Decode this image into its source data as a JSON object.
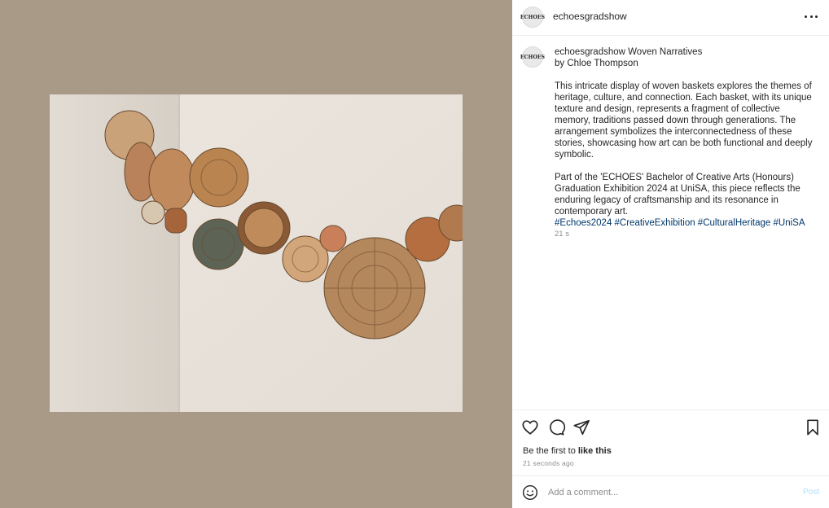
{
  "media": {
    "background_color": "#a99a88",
    "image_semantic": "woven-baskets-wall-photo"
  },
  "header": {
    "avatar_text": "ECHOES",
    "username": "echoesgradshow"
  },
  "caption": {
    "avatar_text": "ECHOES",
    "username": "echoesgradshow",
    "title_line1": " Woven Narratives",
    "title_line2": "by Chloe Thompson",
    "paragraph1": "This intricate display of woven baskets explores the themes of heritage, culture, and connection. Each basket, with its unique texture and design, represents a fragment of collective memory, traditions passed down through generations. The arrangement symbolizes the interconnectedness of these stories, showcasing how art can be both functional and deeply symbolic.",
    "paragraph2": "Part of the 'ECHOES' Bachelor of Creative Arts (Honours) Graduation Exhibition 2024 at UniSA, this piece reflects the enduring legacy of craftsmanship and its resonance in contemporary art.",
    "hashtags": "#Echoes2024 #CreativeExhibition #CulturalHeritage #UniSA",
    "timestamp": "21 s"
  },
  "actions": {
    "likes_prefix": "Be the first to ",
    "likes_bold": "like this",
    "time_ago": "21 seconds ago",
    "icons": [
      "heart-icon",
      "comment-icon",
      "share-icon",
      "bookmark-icon"
    ]
  },
  "comment": {
    "placeholder": "Add a comment...",
    "post_label": "Post"
  },
  "colors": {
    "hashtag": "#00376b",
    "post_disabled": "#b2dffc",
    "muted": "#8e8e8e"
  }
}
